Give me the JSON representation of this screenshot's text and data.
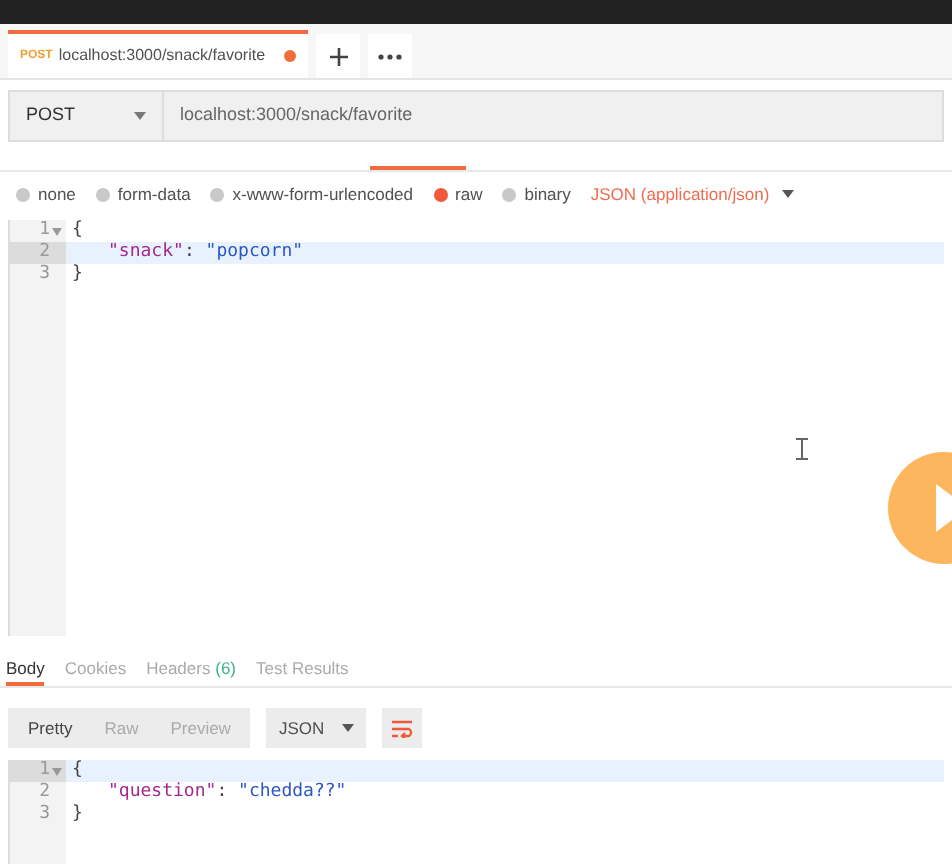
{
  "request_tab": {
    "method": "POST",
    "url": "localhost:3000/snack/favorite",
    "unsaved": true
  },
  "request": {
    "method": "POST",
    "url": "localhost:3000/snack/favorite"
  },
  "body_types": [
    {
      "label": "none",
      "selected": false
    },
    {
      "label": "form-data",
      "selected": false
    },
    {
      "label": "x-www-form-urlencoded",
      "selected": false
    },
    {
      "label": "raw",
      "selected": true
    },
    {
      "label": "binary",
      "selected": false
    }
  ],
  "content_type": "JSON (application/json)",
  "request_editor": {
    "lines": [
      {
        "number": "1",
        "fold": true,
        "highlighted": false,
        "tokens": [
          {
            "kind": "punct",
            "text": "{"
          }
        ]
      },
      {
        "number": "2",
        "fold": false,
        "highlighted": true,
        "tokens": [
          {
            "kind": "key",
            "text": "\"snack\""
          },
          {
            "kind": "punct",
            "text": ": "
          },
          {
            "kind": "string",
            "text": "\"popcorn\""
          }
        ]
      },
      {
        "number": "3",
        "fold": false,
        "highlighted": false,
        "tokens": [
          {
            "kind": "punct",
            "text": "}"
          }
        ]
      }
    ]
  },
  "response_tabs": [
    {
      "label": "Body",
      "selected": true
    },
    {
      "label": "Cookies",
      "selected": false
    },
    {
      "label": "Headers",
      "count": "(6)",
      "selected": false
    },
    {
      "label": "Test Results",
      "selected": false
    }
  ],
  "view_modes": [
    {
      "label": "Pretty",
      "selected": true
    },
    {
      "label": "Raw",
      "selected": false
    },
    {
      "label": "Preview",
      "selected": false
    }
  ],
  "format": "JSON",
  "response_editor": {
    "lines": [
      {
        "number": "1",
        "fold": true,
        "highlighted": true,
        "tokens": [
          {
            "kind": "punct",
            "text": "{"
          }
        ]
      },
      {
        "number": "2",
        "fold": false,
        "highlighted": false,
        "tokens": [
          {
            "kind": "key",
            "text": "\"question\""
          },
          {
            "kind": "punct",
            "text": ": "
          },
          {
            "kind": "string",
            "text": "\"chedda??\""
          }
        ]
      },
      {
        "number": "3",
        "fold": false,
        "highlighted": false,
        "tokens": [
          {
            "kind": "punct",
            "text": "}"
          }
        ]
      }
    ]
  }
}
